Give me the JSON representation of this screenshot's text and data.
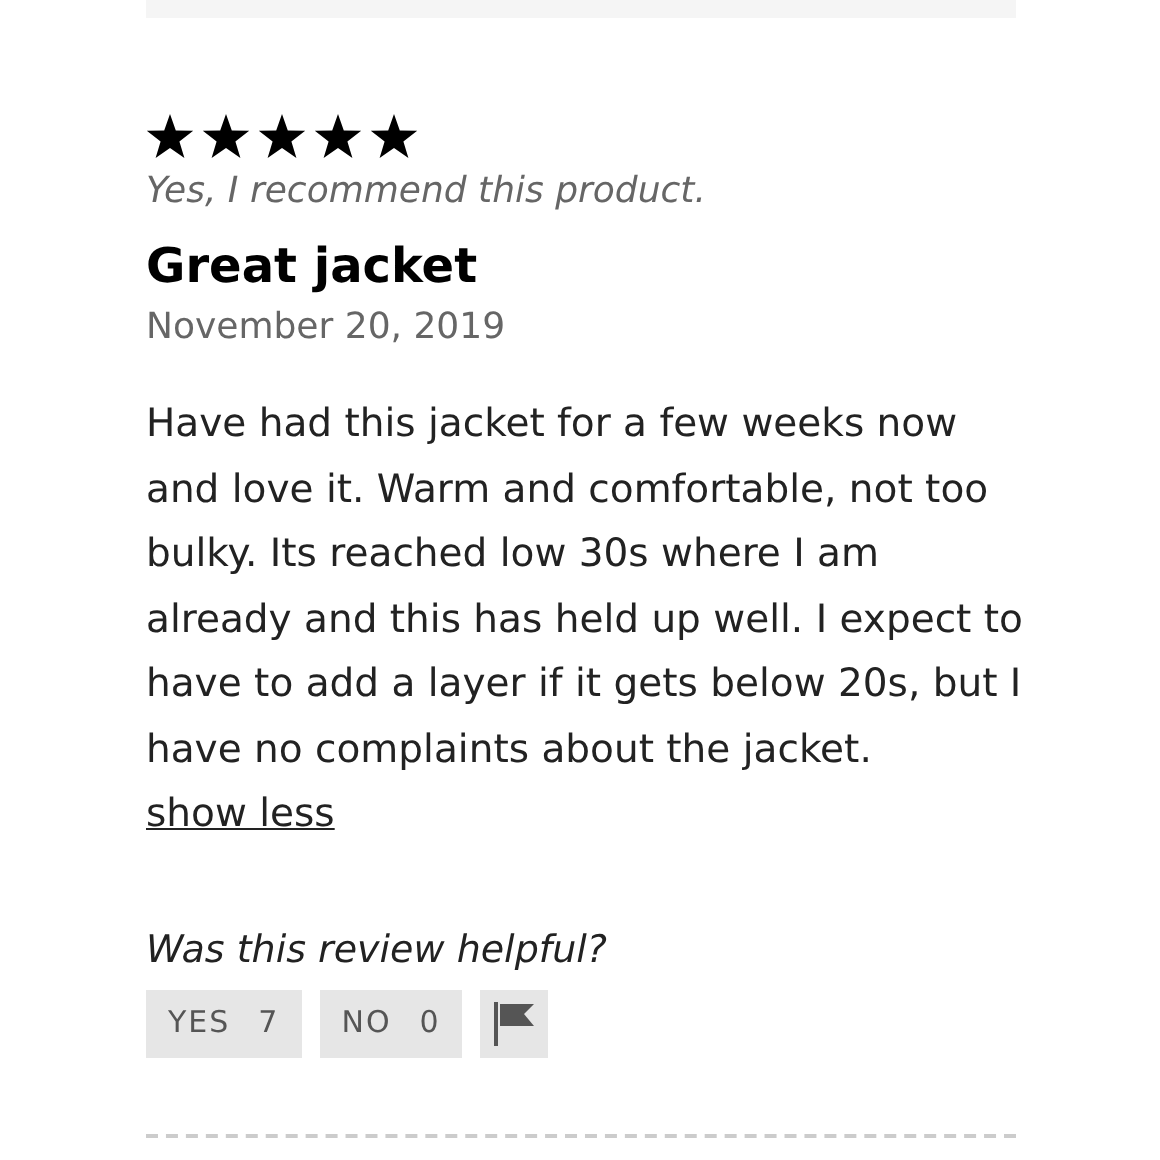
{
  "review": {
    "stars": 5,
    "recommendation": "Yes, I recommend this product.",
    "title": "Great jacket",
    "date": "November 20, 2019",
    "body": "Have had this jacket for a few weeks now and love it. Warm and comfortable, not too bulky. Its reached low 30s where I am already and this has held up well. I expect to have to add a layer if it gets below 20s, but I have no complaints about the jacket.",
    "toggle_link": "show less",
    "helpful_prompt": "Was this review helpful?",
    "votes": [
      {
        "label": "YES",
        "count": "7"
      },
      {
        "label": "NO",
        "count": "0"
      }
    ]
  }
}
